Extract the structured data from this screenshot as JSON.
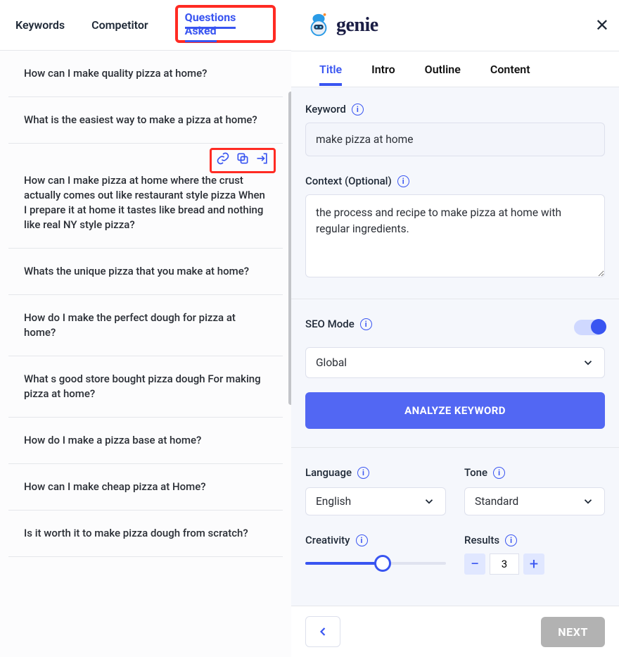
{
  "brand": "genie",
  "left_tabs": {
    "keywords": "Keywords",
    "competitor": "Competitor",
    "questions": "Questions Asked"
  },
  "questions": [
    "How can I make quality pizza at home?",
    "What is the easiest way to make a pizza at home?",
    "How can I make pizza at home where the crust actually comes out like restaurant style pizza When I prepare it at home it tastes like bread and nothing like real NY style pizza?",
    "Whats the unique pizza that you make at home?",
    "How do I make the perfect dough for pizza at home?",
    "What s good store bought pizza dough For making pizza at home?",
    "How do I make a pizza base at home?",
    "How can I make cheap pizza at Home?",
    "Is it worth it to make pizza dough from scratch?"
  ],
  "right_tabs": {
    "title": "Title",
    "intro": "Intro",
    "outline": "Outline",
    "content": "Content"
  },
  "form": {
    "keyword_label": "Keyword",
    "keyword_value": "make pizza at home",
    "context_label": "Context (Optional)",
    "context_value": "the process and recipe to make pizza at home with regular ingredients.",
    "seo_label": "SEO Mode",
    "region_value": "Global",
    "analyze_label": "ANALYZE KEYWORD",
    "language_label": "Language",
    "language_value": "English",
    "tone_label": "Tone",
    "tone_value": "Standard",
    "creativity_label": "Creativity",
    "results_label": "Results",
    "results_value": "3"
  },
  "footer": {
    "next": "NEXT"
  }
}
